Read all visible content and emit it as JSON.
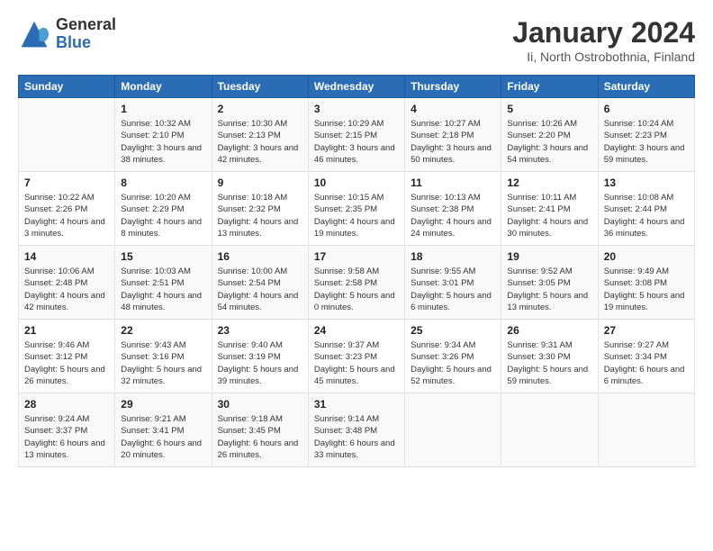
{
  "header": {
    "logo_general": "General",
    "logo_blue": "Blue",
    "title": "January 2024",
    "location": "Ii, North Ostrobothnia, Finland"
  },
  "weekdays": [
    "Sunday",
    "Monday",
    "Tuesday",
    "Wednesday",
    "Thursday",
    "Friday",
    "Saturday"
  ],
  "weeks": [
    [
      {
        "day": "",
        "sunrise": "",
        "sunset": "",
        "daylight": ""
      },
      {
        "day": "1",
        "sunrise": "Sunrise: 10:32 AM",
        "sunset": "Sunset: 2:10 PM",
        "daylight": "Daylight: 3 hours and 38 minutes."
      },
      {
        "day": "2",
        "sunrise": "Sunrise: 10:30 AM",
        "sunset": "Sunset: 2:13 PM",
        "daylight": "Daylight: 3 hours and 42 minutes."
      },
      {
        "day": "3",
        "sunrise": "Sunrise: 10:29 AM",
        "sunset": "Sunset: 2:15 PM",
        "daylight": "Daylight: 3 hours and 46 minutes."
      },
      {
        "day": "4",
        "sunrise": "Sunrise: 10:27 AM",
        "sunset": "Sunset: 2:18 PM",
        "daylight": "Daylight: 3 hours and 50 minutes."
      },
      {
        "day": "5",
        "sunrise": "Sunrise: 10:26 AM",
        "sunset": "Sunset: 2:20 PM",
        "daylight": "Daylight: 3 hours and 54 minutes."
      },
      {
        "day": "6",
        "sunrise": "Sunrise: 10:24 AM",
        "sunset": "Sunset: 2:23 PM",
        "daylight": "Daylight: 3 hours and 59 minutes."
      }
    ],
    [
      {
        "day": "7",
        "sunrise": "Sunrise: 10:22 AM",
        "sunset": "Sunset: 2:26 PM",
        "daylight": "Daylight: 4 hours and 3 minutes."
      },
      {
        "day": "8",
        "sunrise": "Sunrise: 10:20 AM",
        "sunset": "Sunset: 2:29 PM",
        "daylight": "Daylight: 4 hours and 8 minutes."
      },
      {
        "day": "9",
        "sunrise": "Sunrise: 10:18 AM",
        "sunset": "Sunset: 2:32 PM",
        "daylight": "Daylight: 4 hours and 13 minutes."
      },
      {
        "day": "10",
        "sunrise": "Sunrise: 10:15 AM",
        "sunset": "Sunset: 2:35 PM",
        "daylight": "Daylight: 4 hours and 19 minutes."
      },
      {
        "day": "11",
        "sunrise": "Sunrise: 10:13 AM",
        "sunset": "Sunset: 2:38 PM",
        "daylight": "Daylight: 4 hours and 24 minutes."
      },
      {
        "day": "12",
        "sunrise": "Sunrise: 10:11 AM",
        "sunset": "Sunset: 2:41 PM",
        "daylight": "Daylight: 4 hours and 30 minutes."
      },
      {
        "day": "13",
        "sunrise": "Sunrise: 10:08 AM",
        "sunset": "Sunset: 2:44 PM",
        "daylight": "Daylight: 4 hours and 36 minutes."
      }
    ],
    [
      {
        "day": "14",
        "sunrise": "Sunrise: 10:06 AM",
        "sunset": "Sunset: 2:48 PM",
        "daylight": "Daylight: 4 hours and 42 minutes."
      },
      {
        "day": "15",
        "sunrise": "Sunrise: 10:03 AM",
        "sunset": "Sunset: 2:51 PM",
        "daylight": "Daylight: 4 hours and 48 minutes."
      },
      {
        "day": "16",
        "sunrise": "Sunrise: 10:00 AM",
        "sunset": "Sunset: 2:54 PM",
        "daylight": "Daylight: 4 hours and 54 minutes."
      },
      {
        "day": "17",
        "sunrise": "Sunrise: 9:58 AM",
        "sunset": "Sunset: 2:58 PM",
        "daylight": "Daylight: 5 hours and 0 minutes."
      },
      {
        "day": "18",
        "sunrise": "Sunrise: 9:55 AM",
        "sunset": "Sunset: 3:01 PM",
        "daylight": "Daylight: 5 hours and 6 minutes."
      },
      {
        "day": "19",
        "sunrise": "Sunrise: 9:52 AM",
        "sunset": "Sunset: 3:05 PM",
        "daylight": "Daylight: 5 hours and 13 minutes."
      },
      {
        "day": "20",
        "sunrise": "Sunrise: 9:49 AM",
        "sunset": "Sunset: 3:08 PM",
        "daylight": "Daylight: 5 hours and 19 minutes."
      }
    ],
    [
      {
        "day": "21",
        "sunrise": "Sunrise: 9:46 AM",
        "sunset": "Sunset: 3:12 PM",
        "daylight": "Daylight: 5 hours and 26 minutes."
      },
      {
        "day": "22",
        "sunrise": "Sunrise: 9:43 AM",
        "sunset": "Sunset: 3:16 PM",
        "daylight": "Daylight: 5 hours and 32 minutes."
      },
      {
        "day": "23",
        "sunrise": "Sunrise: 9:40 AM",
        "sunset": "Sunset: 3:19 PM",
        "daylight": "Daylight: 5 hours and 39 minutes."
      },
      {
        "day": "24",
        "sunrise": "Sunrise: 9:37 AM",
        "sunset": "Sunset: 3:23 PM",
        "daylight": "Daylight: 5 hours and 45 minutes."
      },
      {
        "day": "25",
        "sunrise": "Sunrise: 9:34 AM",
        "sunset": "Sunset: 3:26 PM",
        "daylight": "Daylight: 5 hours and 52 minutes."
      },
      {
        "day": "26",
        "sunrise": "Sunrise: 9:31 AM",
        "sunset": "Sunset: 3:30 PM",
        "daylight": "Daylight: 5 hours and 59 minutes."
      },
      {
        "day": "27",
        "sunrise": "Sunrise: 9:27 AM",
        "sunset": "Sunset: 3:34 PM",
        "daylight": "Daylight: 6 hours and 6 minutes."
      }
    ],
    [
      {
        "day": "28",
        "sunrise": "Sunrise: 9:24 AM",
        "sunset": "Sunset: 3:37 PM",
        "daylight": "Daylight: 6 hours and 13 minutes."
      },
      {
        "day": "29",
        "sunrise": "Sunrise: 9:21 AM",
        "sunset": "Sunset: 3:41 PM",
        "daylight": "Daylight: 6 hours and 20 minutes."
      },
      {
        "day": "30",
        "sunrise": "Sunrise: 9:18 AM",
        "sunset": "Sunset: 3:45 PM",
        "daylight": "Daylight: 6 hours and 26 minutes."
      },
      {
        "day": "31",
        "sunrise": "Sunrise: 9:14 AM",
        "sunset": "Sunset: 3:48 PM",
        "daylight": "Daylight: 6 hours and 33 minutes."
      },
      {
        "day": "",
        "sunrise": "",
        "sunset": "",
        "daylight": ""
      },
      {
        "day": "",
        "sunrise": "",
        "sunset": "",
        "daylight": ""
      },
      {
        "day": "",
        "sunrise": "",
        "sunset": "",
        "daylight": ""
      }
    ]
  ]
}
